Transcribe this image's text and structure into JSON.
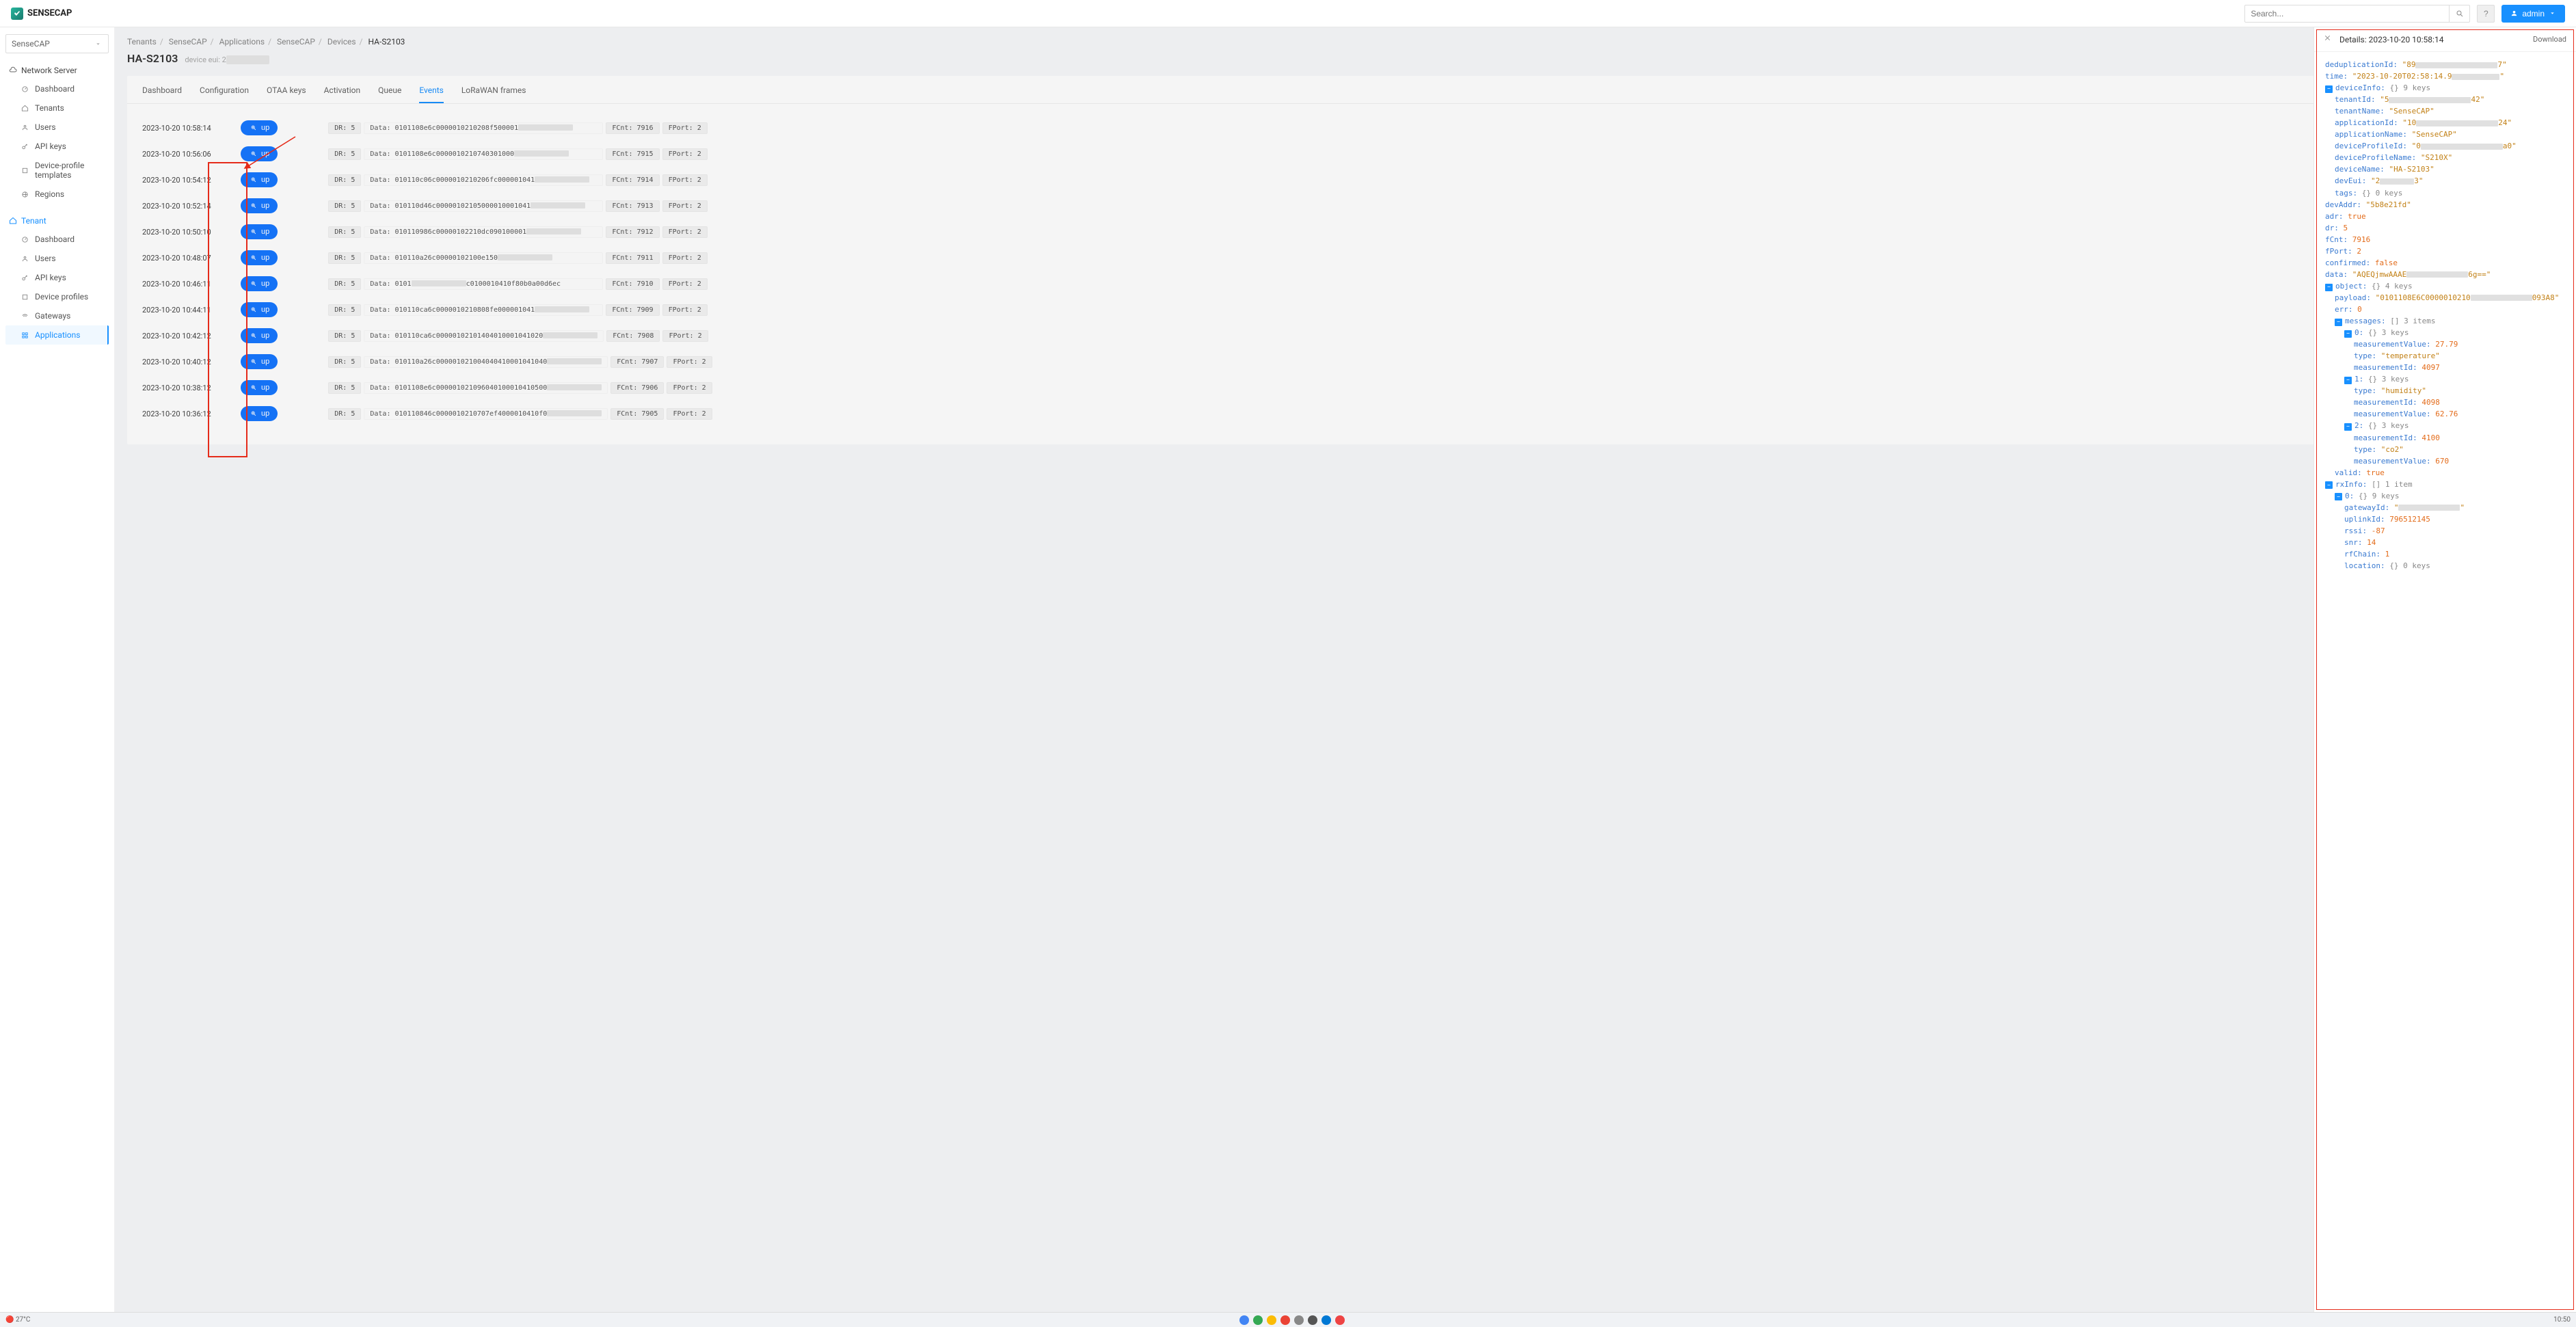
{
  "brand": "SENSECAP",
  "search": {
    "placeholder": "Search..."
  },
  "user": {
    "label": "admin"
  },
  "tenant_select": "SenseCAP",
  "sidebar": {
    "sections": [
      {
        "label": "Network Server",
        "icon": "cloud",
        "items": [
          {
            "label": "Dashboard",
            "icon": "dashboard"
          },
          {
            "label": "Tenants",
            "icon": "home"
          },
          {
            "label": "Users",
            "icon": "user"
          },
          {
            "label": "API keys",
            "icon": "key"
          },
          {
            "label": "Device-profile templates",
            "icon": "layers"
          },
          {
            "label": "Regions",
            "icon": "globe"
          }
        ]
      },
      {
        "label": "Tenant",
        "icon": "home",
        "items": [
          {
            "label": "Dashboard",
            "icon": "dashboard"
          },
          {
            "label": "Users",
            "icon": "user"
          },
          {
            "label": "API keys",
            "icon": "key"
          },
          {
            "label": "Device profiles",
            "icon": "layers"
          },
          {
            "label": "Gateways",
            "icon": "wifi"
          },
          {
            "label": "Applications",
            "icon": "apps"
          }
        ]
      }
    ]
  },
  "breadcrumb": [
    "Tenants",
    "SenseCAP",
    "Applications",
    "SenseCAP",
    "Devices",
    "HA-S2103"
  ],
  "page": {
    "title": "HA-S2103",
    "sub_label": "device eui: 2"
  },
  "tabs": [
    "Dashboard",
    "Configuration",
    "OTAA keys",
    "Activation",
    "Queue",
    "Events",
    "LoRaWAN frames"
  ],
  "active_tab": "Events",
  "button_label": "up",
  "events": [
    {
      "time": "2023-10-20 10:58:14",
      "dr": "5",
      "data": "0101108e6c0000010210208f500001",
      "fcnt": "7916",
      "fport": "2"
    },
    {
      "time": "2023-10-20 10:56:06",
      "dr": "5",
      "data": "0101108e6c0000010210740301000",
      "fcnt": "7915",
      "fport": "2"
    },
    {
      "time": "2023-10-20 10:54:12",
      "dr": "5",
      "data": "010110c06c0000010210206fc000001041",
      "fcnt": "7914",
      "fport": "2"
    },
    {
      "time": "2023-10-20 10:52:14",
      "dr": "5",
      "data": "010110d46c00000102105000010001041",
      "fcnt": "7913",
      "fport": "2"
    },
    {
      "time": "2023-10-20 10:50:10",
      "dr": "5",
      "data": "010110986c00000102210dc090100001",
      "fcnt": "7912",
      "fport": "2"
    },
    {
      "time": "2023-10-20 10:48:07",
      "dr": "5",
      "data": "010110a26c00000102100e150",
      "fcnt": "7911",
      "fport": "2"
    },
    {
      "time": "2023-10-20 10:46:11",
      "dr": "5",
      "data": "0101",
      "data_ext": "c0100010410f80b0a00d6ec",
      "fcnt": "7910",
      "fport": "2"
    },
    {
      "time": "2023-10-20 10:44:11",
      "dr": "5",
      "data": "010110ca6c0000010210808fe000001041",
      "fcnt": "7909",
      "fport": "2"
    },
    {
      "time": "2023-10-20 10:42:12",
      "dr": "5",
      "data": "010110ca6c00000102101404010001041020",
      "fcnt": "7908",
      "fport": "2"
    },
    {
      "time": "2023-10-20 10:40:12",
      "dr": "5",
      "data": "010110a26c000001021004040410001041040",
      "fcnt": "7907",
      "fport": "2"
    },
    {
      "time": "2023-10-20 10:38:12",
      "dr": "5",
      "data": "0101108e6c000001021096040100010410500",
      "fcnt": "7906",
      "fport": "2"
    },
    {
      "time": "2023-10-20 10:36:12",
      "dr": "5",
      "data": "010110846c0000010210707ef4000010410f0",
      "fcnt": "7905",
      "fport": "2"
    }
  ],
  "details": {
    "title": "Details: 2023-10-20 10:58:14",
    "download": "Download",
    "deduplicationId": {
      "pre": "89",
      "post": "7"
    },
    "time": {
      "pre": "2023-10-20T02:58:14.9"
    },
    "deviceInfo": {
      "_meta": "{} 9 keys",
      "tenantId": {
        "pre": "5",
        "post": "42"
      },
      "tenantName": "SenseCAP",
      "applicationId": {
        "pre": "10",
        "post": "24"
      },
      "applicationName": "SenseCAP",
      "deviceProfileId": {
        "pre": "0",
        "post": "a0"
      },
      "deviceProfileName": "S210X",
      "deviceName": "HA-S2103",
      "devEui": {
        "pre": "2",
        "post": "3"
      },
      "tags": "{} 0 keys"
    },
    "devAddr": "5b8e21fd",
    "adr": true,
    "dr": 5,
    "fCnt": 7916,
    "fPort": 2,
    "confirmed": false,
    "data": {
      "pre": "AQEQjmwAAAE",
      "post": "6g=="
    },
    "object": {
      "_meta": "{} 4 keys",
      "payload": {
        "pre": "0101108E6C0000010210",
        "post": "093A8"
      },
      "err": 0,
      "messages": {
        "_meta": "[] 3 items",
        "items": [
          {
            "_meta": "{} 3 keys",
            "measurementValue": 27.79,
            "type": "temperature",
            "measurementId": 4097
          },
          {
            "_meta": "{} 3 keys",
            "type": "humidity",
            "measurementId": 4098,
            "measurementValue": 62.76
          },
          {
            "_meta": "{} 3 keys",
            "measurementId": 4100,
            "type": "co2",
            "measurementValue": 670
          }
        ]
      },
      "valid": true
    },
    "rxInfo": {
      "_meta": "[] 1 item",
      "items": [
        {
          "_meta": "{} 9 keys",
          "gatewayId": {
            "pre": ""
          },
          "uplinkId": 796512145,
          "rssi": -87,
          "snr": 14,
          "rfChain": 1,
          "location": "{} 0 keys"
        }
      ]
    }
  },
  "taskbar": {
    "temp": "27°C",
    "clock": "10:50"
  }
}
